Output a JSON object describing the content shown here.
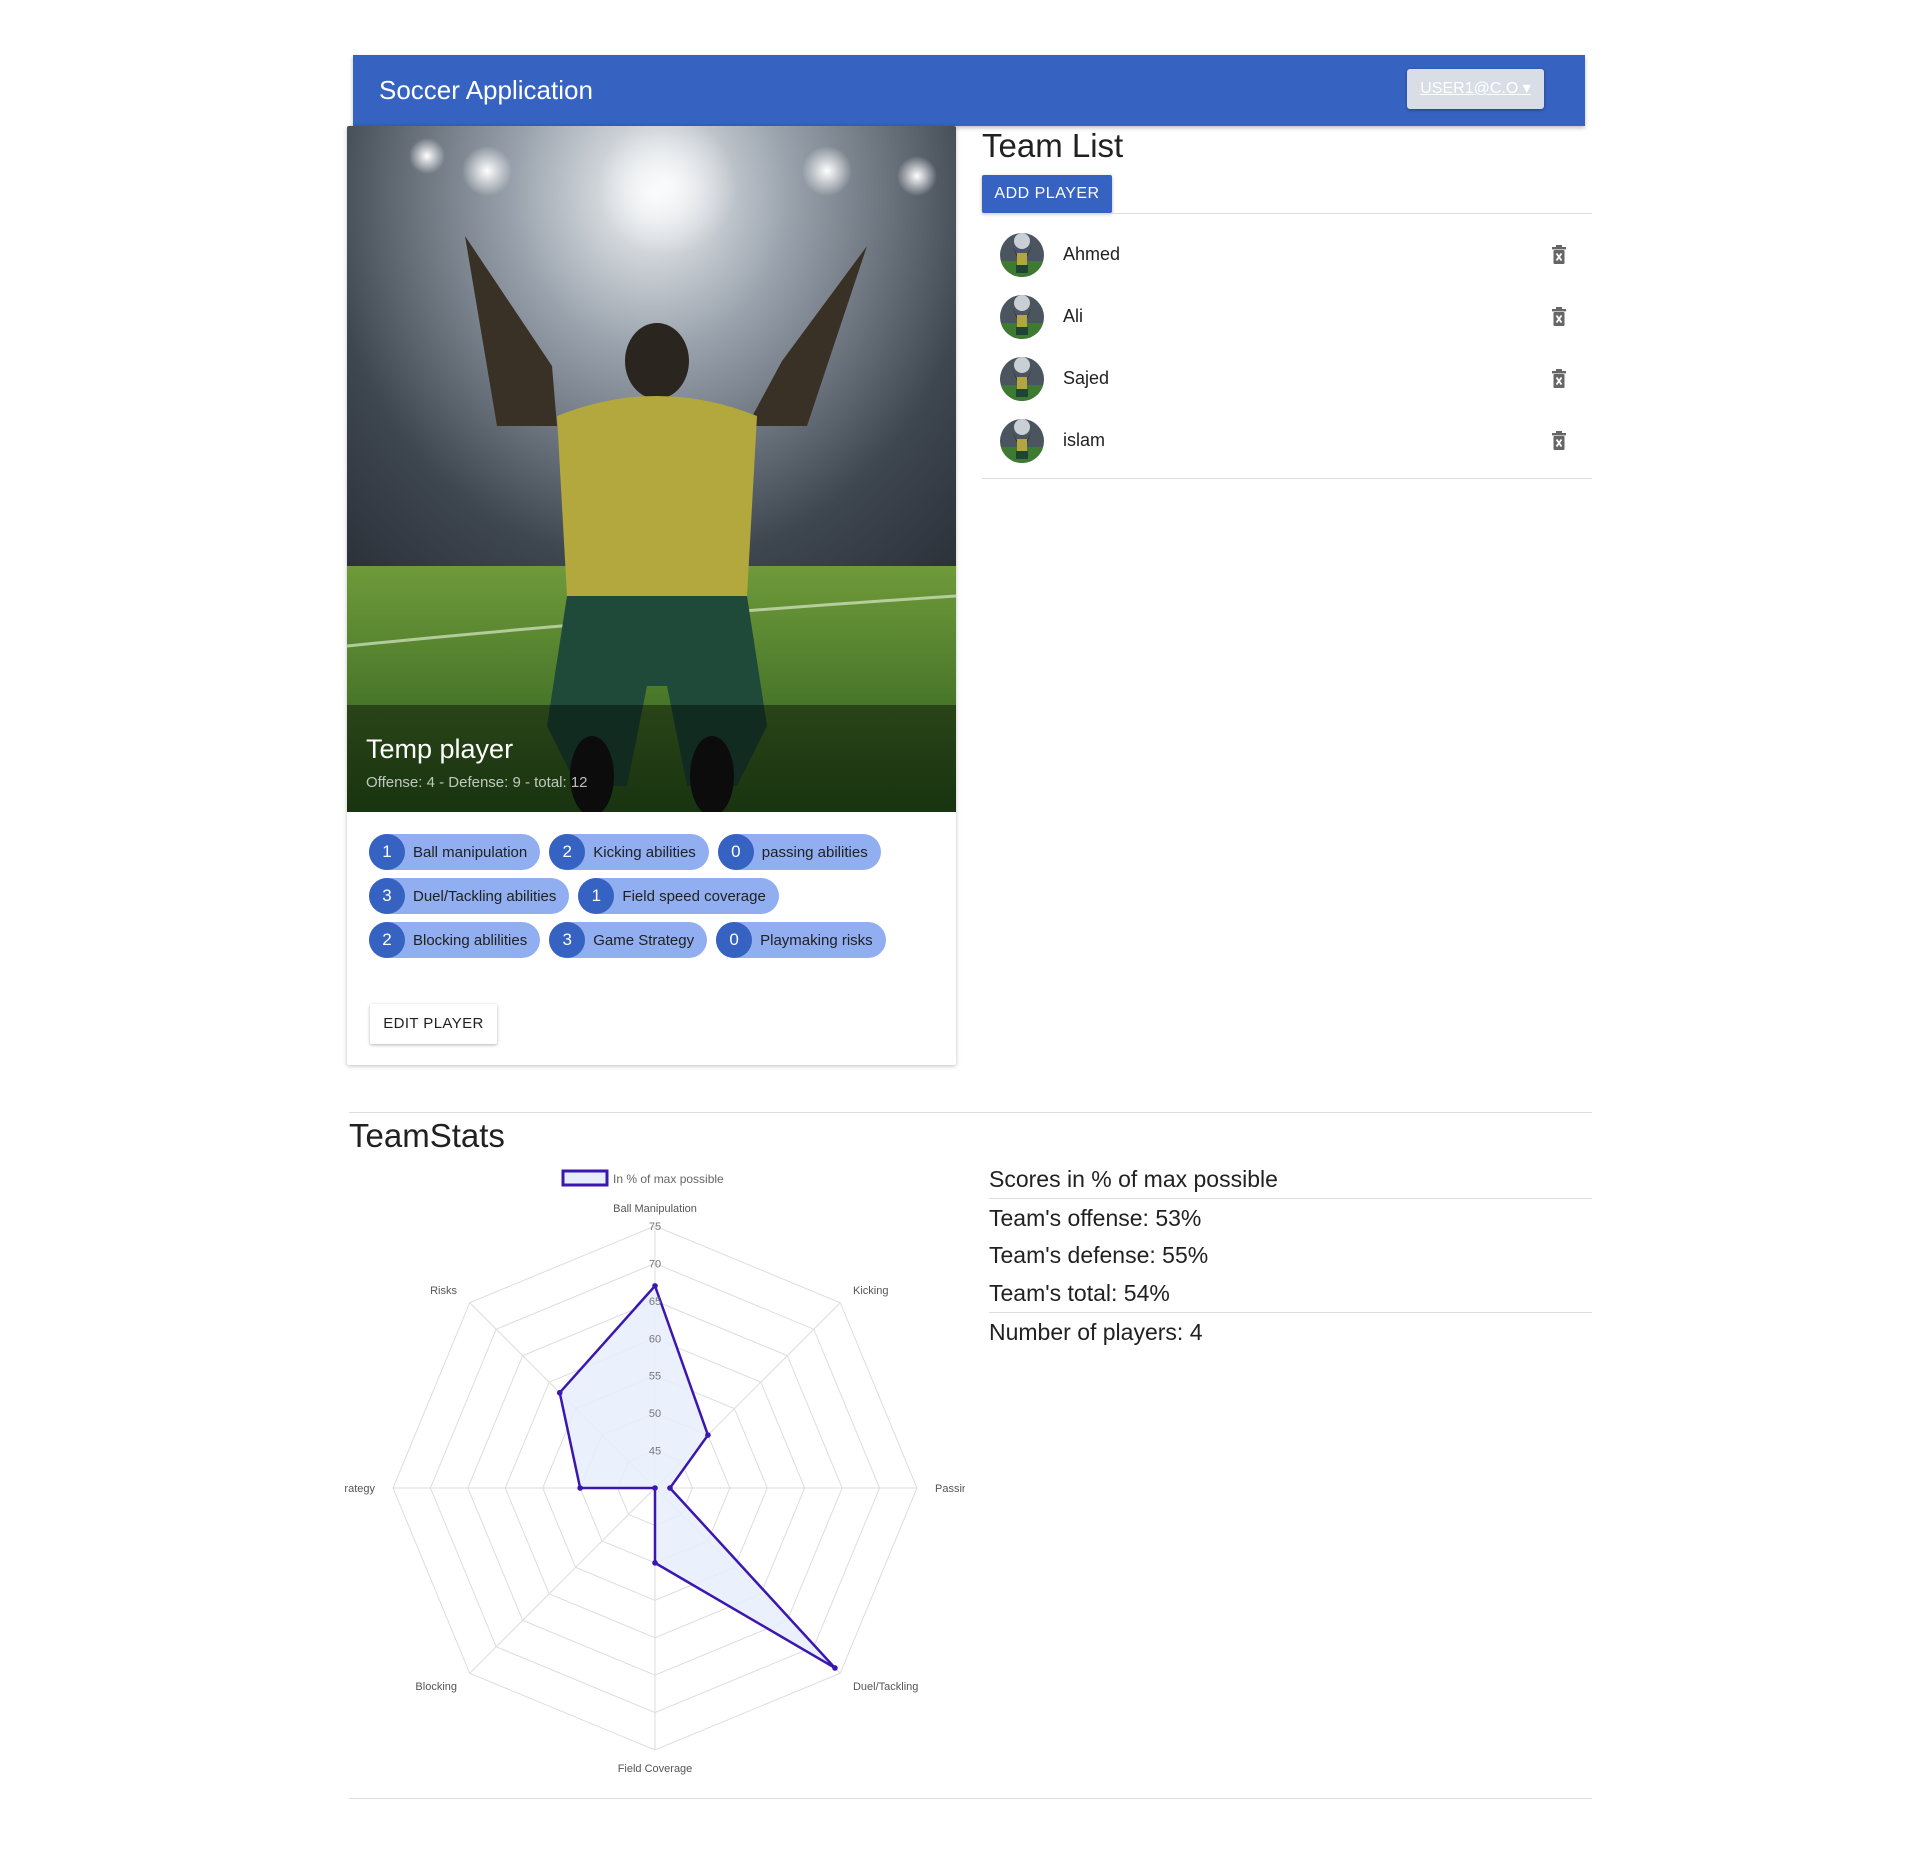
{
  "header": {
    "title": "Soccer Application",
    "user_menu_label": "USER1@C.O ▾"
  },
  "player_card": {
    "name": "Temp player",
    "summary": "Offense: 4 - Defense: 9 - total: 12",
    "skills": [
      {
        "value": "1",
        "label": "Ball manipulation"
      },
      {
        "value": "2",
        "label": "Kicking abilities"
      },
      {
        "value": "0",
        "label": "passing abilities"
      },
      {
        "value": "3",
        "label": "Duel/Tackling abilities"
      },
      {
        "value": "1",
        "label": "Field speed coverage"
      },
      {
        "value": "2",
        "label": "Blocking ablilities"
      },
      {
        "value": "3",
        "label": "Game Strategy"
      },
      {
        "value": "0",
        "label": "Playmaking risks"
      }
    ],
    "edit_button": "EDIT PLAYER"
  },
  "team_list": {
    "title": "Team List",
    "add_button": "ADD PLAYER",
    "players": [
      "Ahmed",
      "Ali",
      "Sajed",
      "islam"
    ],
    "delete_icon": "trash-icon"
  },
  "team_stats": {
    "title": "TeamStats",
    "scores_heading": "Scores in % of max possible",
    "offense": "Team's offense: 53%",
    "defense": "Team's defense: 55%",
    "total": "Team's total: 54%",
    "players_count": "Number of players: 4"
  },
  "chart_data": {
    "type": "radar",
    "axes": [
      "Ball Manipulation",
      "Kicking",
      "Passing",
      "Duel/Tackling",
      "Field Coverage",
      "Blocking",
      "Strategy",
      "Risks"
    ],
    "ticks": [
      45,
      50,
      55,
      60,
      65,
      70,
      75
    ],
    "range": [
      40,
      75
    ],
    "series": [
      {
        "name": "In % of max possible",
        "values": [
          67,
          50,
          42,
          74,
          50,
          40,
          50,
          58
        ]
      }
    ],
    "colors": {
      "line": "#3b17b0",
      "fill": "#e6edfc",
      "grid": "#dddddd"
    }
  }
}
